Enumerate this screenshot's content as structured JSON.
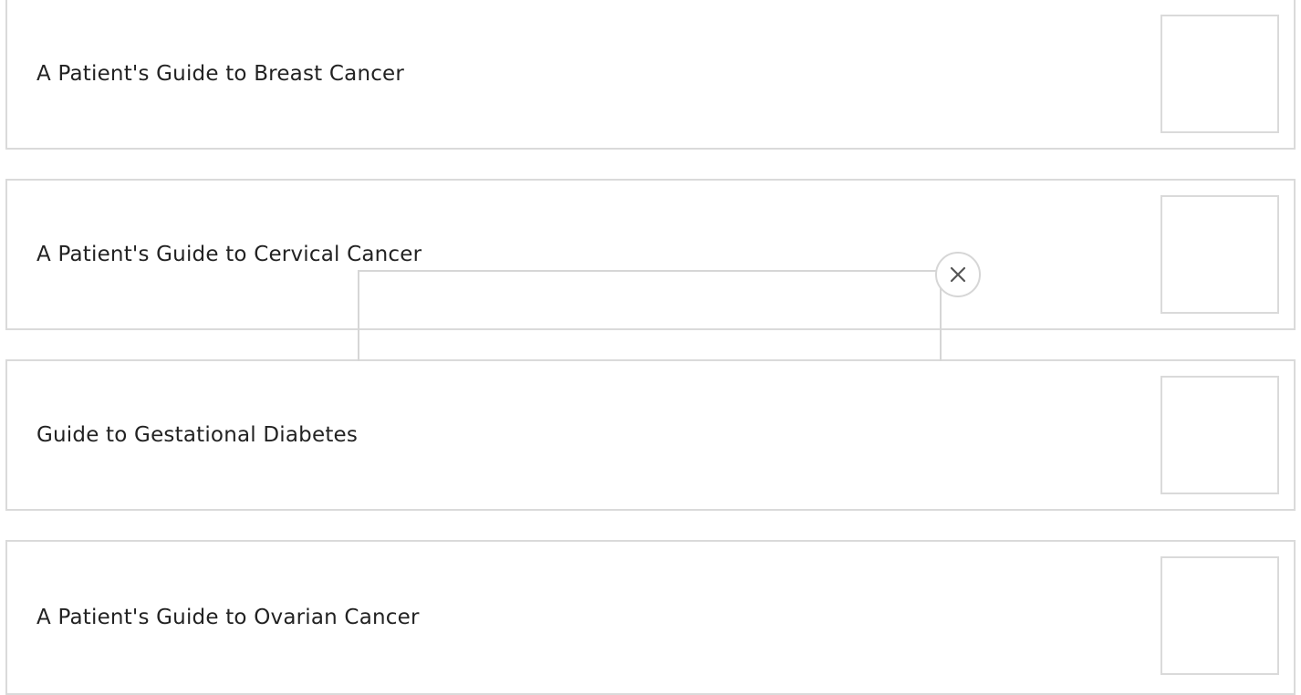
{
  "guides": [
    {
      "title": "A Patient's Guide to Breast Cancer"
    },
    {
      "title": "A Patient's Guide to Cervical Cancer"
    },
    {
      "title": "Guide to Gestational Diabetes"
    },
    {
      "title": "A Patient's Guide to Ovarian Cancer"
    }
  ],
  "popup": {
    "close_icon": "close-icon"
  },
  "colors": {
    "border": "#dadada",
    "text": "#222222",
    "icon": "#555555"
  }
}
